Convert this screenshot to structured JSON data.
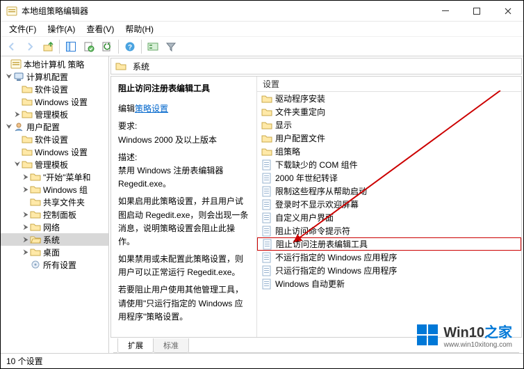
{
  "window": {
    "title": "本地组策略编辑器"
  },
  "menu": {
    "file": "文件(F)",
    "action": "操作(A)",
    "view": "查看(V)",
    "help": "帮助(H)"
  },
  "tree": {
    "root": "本地计算机 策略",
    "computer": {
      "label": "计算机配置",
      "soft": "软件设置",
      "windows": "Windows 设置",
      "admin": "管理模板"
    },
    "user": {
      "label": "用户配置",
      "soft": "软件设置",
      "windows": "Windows 设置",
      "admin": {
        "label": "管理模板",
        "start": "\"开始\"菜单和",
        "wincomp": "Windows 组",
        "shared": "共享文件夹",
        "cpanel": "控制面板",
        "network": "网络",
        "system": "系统",
        "desktop": "桌面",
        "allset": "所有设置"
      }
    }
  },
  "crumb": {
    "label": "系统"
  },
  "desc": {
    "title": "阻止访问注册表编辑工具",
    "editPrefix": "编辑",
    "editLink": "策略设置",
    "reqLabel": "要求:",
    "reqText": "Windows 2000 及以上版本",
    "descLabel": "描述:",
    "p1": "禁用 Windows 注册表编辑器 Regedit.exe。",
    "p2": "如果启用此策略设置，并且用户试图启动 Regedit.exe，则会出现一条消息，说明策略设置会阻止此操作。",
    "p3": "如果禁用或未配置此策略设置，则用户可以正常运行 Regedit.exe。",
    "p4": "若要阻止用户使用其他管理工具，请使用\"只运行指定的 Windows 应用程序\"策略设置。"
  },
  "list": {
    "header": "设置",
    "items": [
      {
        "type": "folder",
        "label": "驱动程序安装"
      },
      {
        "type": "folder",
        "label": "文件夹重定向"
      },
      {
        "type": "folder",
        "label": "显示"
      },
      {
        "type": "folder",
        "label": "用户配置文件"
      },
      {
        "type": "folder",
        "label": "组策略"
      },
      {
        "type": "setting",
        "label": "下载缺少的 COM 组件"
      },
      {
        "type": "setting",
        "label": "2000 年世纪转译"
      },
      {
        "type": "setting",
        "label": "限制这些程序从帮助启动"
      },
      {
        "type": "setting",
        "label": "登录时不显示欢迎屏幕"
      },
      {
        "type": "setting",
        "label": "自定义用户界面"
      },
      {
        "type": "setting",
        "label": "阻止访问命令提示符"
      },
      {
        "type": "setting",
        "label": "阻止访问注册表编辑工具",
        "hi": true
      },
      {
        "type": "setting",
        "label": "不运行指定的 Windows 应用程序"
      },
      {
        "type": "setting",
        "label": "只运行指定的 Windows 应用程序"
      },
      {
        "type": "setting",
        "label": "Windows 自动更新"
      }
    ]
  },
  "tabs": {
    "extended": "扩展",
    "standard": "标准"
  },
  "status": {
    "count": "10 个设置"
  },
  "watermark": {
    "brand": "Win10",
    "suffix": "之家",
    "url": "www.win10xitong.com"
  }
}
